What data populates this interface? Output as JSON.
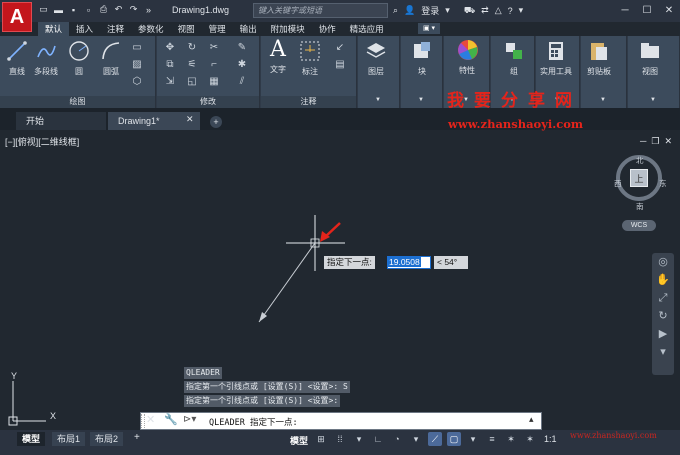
{
  "app": {
    "logo": "A",
    "document_title": "Drawing1.dwg",
    "search_placeholder": "键入关键字或短语",
    "login_label": "登录"
  },
  "quick_access": [
    "new-file-icon",
    "open-folder-icon",
    "save-icon",
    "save-as-icon",
    "print-icon",
    "undo-icon",
    "redo-icon",
    "more-icon"
  ],
  "ribbon_tabs": [
    "默认",
    "插入",
    "注释",
    "参数化",
    "视图",
    "管理",
    "输出",
    "附加模块",
    "协作",
    "精选应用"
  ],
  "ribbon_tab_extra": "▣ ▾",
  "ribbon": {
    "draw": {
      "panel_label": "绘图",
      "line": "直线",
      "polyline": "多段线",
      "circle": "圆",
      "arc": "圆弧"
    },
    "modify": {
      "panel_label": "修改"
    },
    "annotation": {
      "panel_label": "注释",
      "text": "文字",
      "dimension": "标注"
    },
    "layers": "图层",
    "block": "块",
    "properties": "特性",
    "group": "组",
    "utilities": "实用工具",
    "clipboard": "剪贴板",
    "view": "视图"
  },
  "doc_tabs": {
    "start": "开始",
    "drawing": "Drawing1*"
  },
  "watermark": {
    "cn": "我要分享网",
    "url": "www.zhanshaoyi.com"
  },
  "canvas": {
    "view_label": "[−][俯视][二维线框]",
    "viewcube": {
      "face": "上",
      "north": "北",
      "south": "南",
      "east": "东",
      "west": "西",
      "wcs": "WCS"
    },
    "ucs": {
      "y": "Y",
      "x": "X"
    }
  },
  "dynamic_input": {
    "prompt": "指定下一点:",
    "value": "19.0508",
    "angle": "< 54°"
  },
  "command_history": [
    "QLEADER",
    "指定第一个引线点或 [设置(S)] <设置>: S",
    "指定第一个引线点或 [设置(S)] <设置>:"
  ],
  "command_line": {
    "text": "QLEADER 指定下一点:"
  },
  "layout_tabs": [
    "模型",
    "布局1",
    "布局2"
  ],
  "statusbar": {
    "model": "模型",
    "scale": "1:1"
  },
  "colors": {
    "accent_red": "#c3161c",
    "ribbon": "#3c4b5c",
    "canvas": "#212830",
    "highlight": "#1c6fd1"
  }
}
